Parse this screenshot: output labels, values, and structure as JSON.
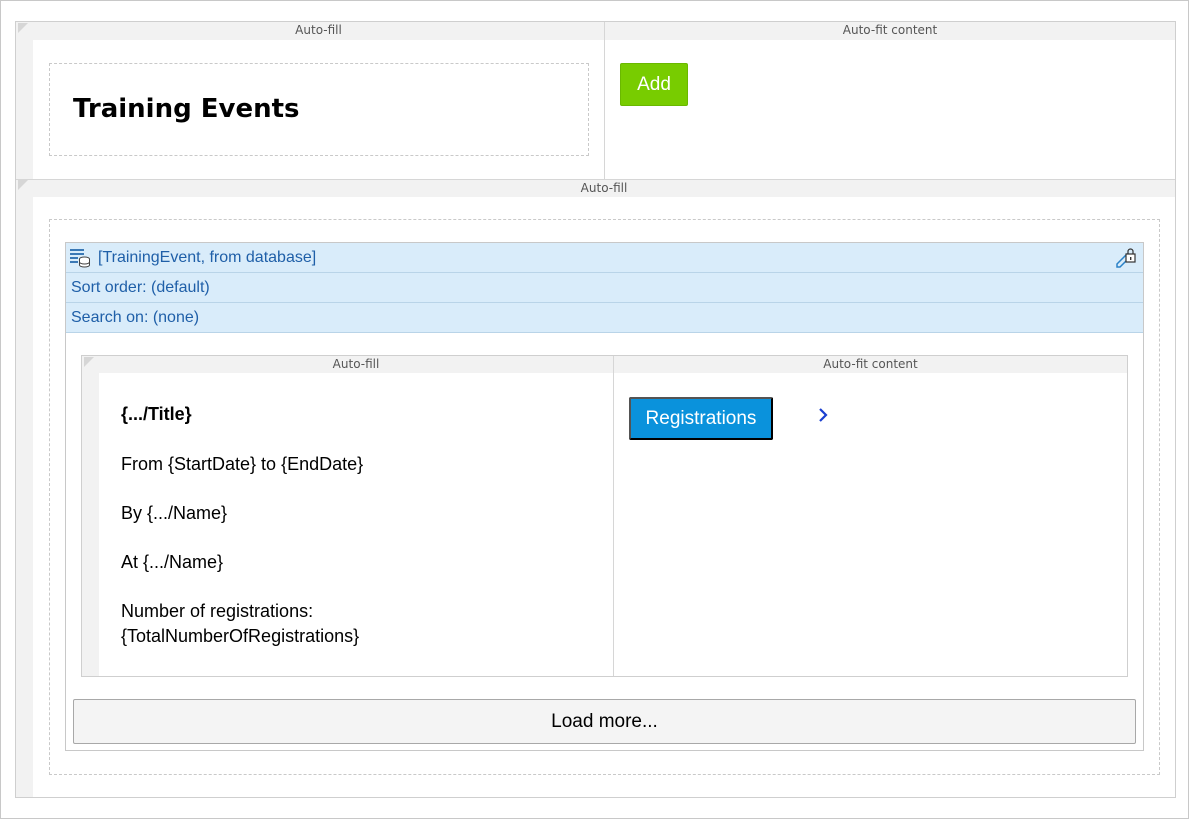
{
  "header_row": {
    "col1_label": "Auto-fill",
    "col2_label": "Auto-fit content",
    "title": "Training Events",
    "add_button": "Add",
    "add_color": "#78cc00"
  },
  "body_row": {
    "label": "Auto-fill"
  },
  "list": {
    "datasource": "[TrainingEvent, from database]",
    "sort_order": "Sort order: (default)",
    "search_on": "Search on: (none)",
    "datasource_icon": "database-list-icon",
    "lock_icon": "lock-edit-icon",
    "item": {
      "col1_label": "Auto-fill",
      "col2_label": "Auto-fit content",
      "title_field": "{.../Title}",
      "dates_field": "From {StartDate} to {EndDate}",
      "by_field": "By {.../Name}",
      "at_field": "At {.../Name}",
      "registrations_line1": "Number of registrations:",
      "registrations_line2": "{TotalNumberOfRegistrations}",
      "registrations_button": "Registrations",
      "registrations_color": "#0a92dc",
      "chevron_icon": "chevron-right-icon"
    },
    "load_more": "Load more..."
  }
}
